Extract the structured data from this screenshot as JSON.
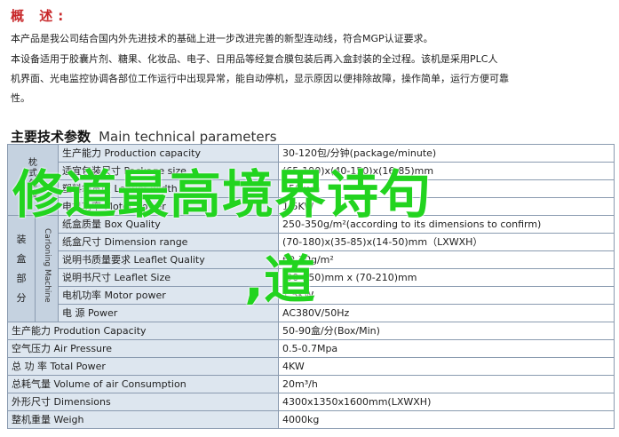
{
  "overview": {
    "heading": "概 述:",
    "lines": [
      "本产品是我公司结合国内外先进技术的基础上进一步改进完善的新型连动线，符合MGP认证要求。",
      "本设备适用于胶囊片剂、糖果、化妆品、电子、日用品等经复合膜包装后再入盒封装的全过程。该机是采用PLC人",
      "机界面、光电监控协调各部位工作运行中出现异常，能自动停机，显示原因以便排除故障，操作简单，运行方便可靠",
      "性。"
    ]
  },
  "tech": {
    "heading_cn": "主要技术参数",
    "heading_en": "Main technical parameters",
    "rows_group1": [
      {
        "label": "生产能力 Production capacity",
        "value": "30-120包/分钟(package/minute)"
      },
      {
        "label": "适宜包装尺寸 Package size",
        "value": "(65-190)x(40-150)x(16-85)mm"
      },
      {
        "label": "塑料袋宽度 Leaflet width",
        "value": "250mm"
      },
      {
        "label": "电机功率 Motor power",
        "value": "1.5KW"
      }
    ],
    "group1_label": "枕式包装",
    "rows_group2": [
      {
        "label": "纸盒质量 Box Quality",
        "value": "250-350g/m²(according to its dimensions to confirm)"
      },
      {
        "label": "纸盒尺寸 Dimension range",
        "value": "(70-180)x(35-85)x(14-50)mm（LXWXH）"
      },
      {
        "label": "说明书质量要求 Leaflet  Quality",
        "value": "60-70g/m²"
      },
      {
        "label": "说明书尺寸 Leaflet  Size",
        "value": "(90-250)mm x (70-210)mm"
      },
      {
        "label": "电机功率 Motor power",
        "value": "1.5KW"
      },
      {
        "label": "电      源 Power",
        "value": "AC380V/50Hz"
      }
    ],
    "group2_label": "装盒部分",
    "group2_sub": "Carloning Machine",
    "rows_general": [
      {
        "label": "生产能力 Prodution Capacity",
        "value": "50-90盒/分(Box/Min)"
      },
      {
        "label": "空气压力 Air Pressure",
        "value": "0.5-0.7Mpa"
      },
      {
        "label": "总 功 率 Total Power",
        "value": "4KW"
      },
      {
        "label": "总耗气量 Volume of air Consumption",
        "value": "20m³/h"
      },
      {
        "label": "外形尺寸 Dimensions",
        "value": "4300x1350x1600mm(LXWXH)"
      },
      {
        "label": "整机重量 Weigh",
        "value": "4000kg"
      }
    ]
  },
  "watermark": {
    "line1": "修道最高境界诗句",
    "line2": ",道"
  }
}
